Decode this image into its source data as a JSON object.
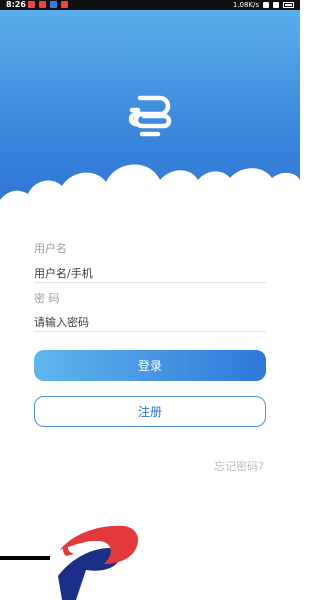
{
  "status_bar": {
    "time": "8:26",
    "network_speed": "1.08K/s"
  },
  "colors": {
    "header_top": "#5aaeea",
    "header_bottom": "#2f74d4",
    "accent": "#2f78d8",
    "label_gray": "#9aa0a8",
    "logo_red": "#e23a3a",
    "logo_navy": "#1c2f86"
  },
  "header": {
    "logo_icon": "app-logo-icon"
  },
  "form": {
    "username_label": "用户名",
    "username_placeholder": "用户名/手机",
    "password_label": "密 码",
    "password_placeholder": "请输入密码",
    "login_button": "登录",
    "register_button": "注册",
    "forgot_password": "忘记密码?"
  }
}
